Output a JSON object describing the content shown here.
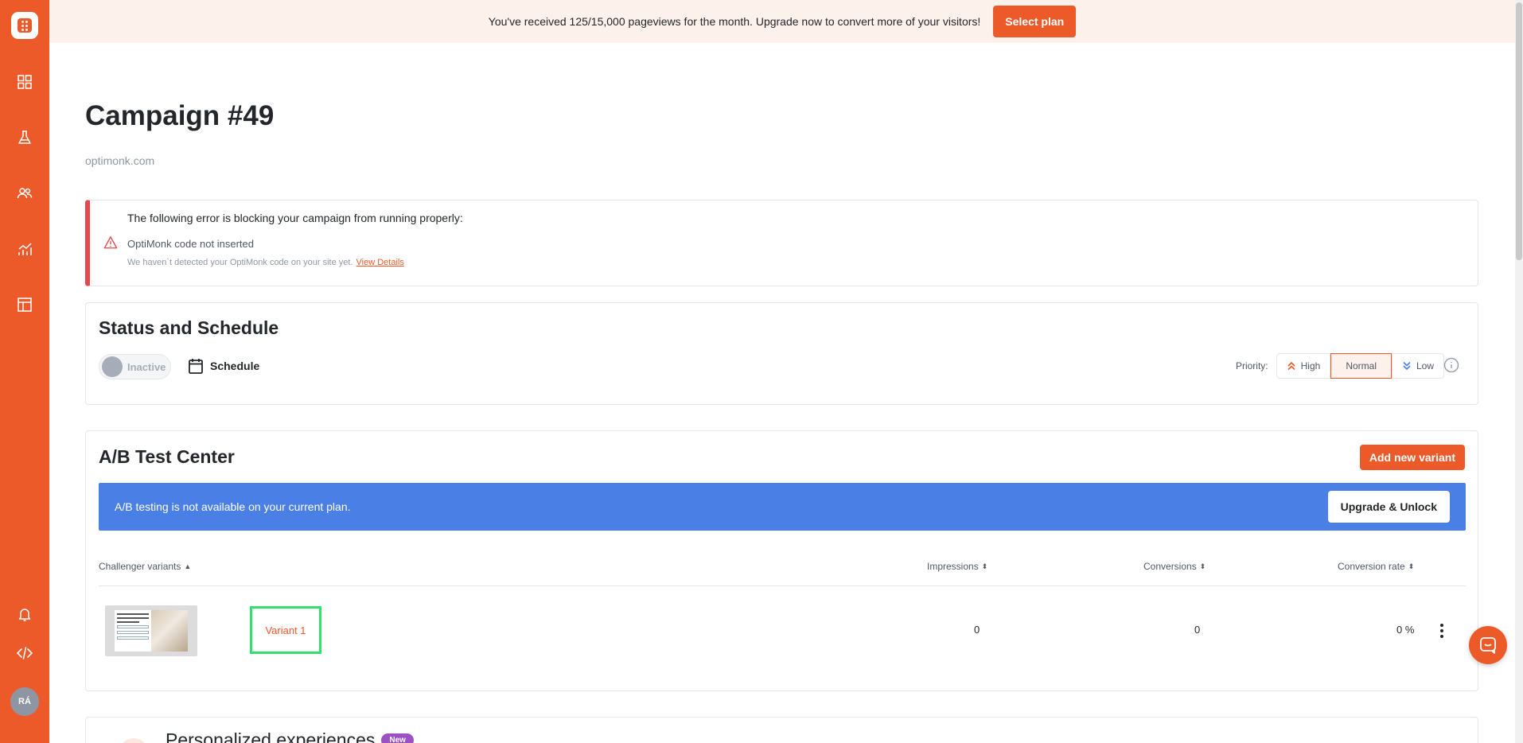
{
  "banner": {
    "text": "You've received 125/15,000 pageviews for the month. Upgrade now to convert more of your visitors!",
    "button": "Select plan"
  },
  "sidebar": {
    "items": [
      {
        "icon": "dashboard-icon"
      },
      {
        "icon": "flask-icon"
      },
      {
        "icon": "users-icon"
      },
      {
        "icon": "analytics-icon"
      },
      {
        "icon": "templates-icon"
      }
    ],
    "bottom": [
      {
        "icon": "bell-icon"
      },
      {
        "icon": "code-icon"
      }
    ],
    "avatar": "RÁ"
  },
  "header": {
    "title": "Campaign #49",
    "domain": "optimonk.com"
  },
  "error": {
    "title": "The following error is blocking your campaign from running properly:",
    "subtitle": "OptiMonk code not inserted",
    "description": "We haven`t detected your OptiMonk code on your site yet.",
    "link": "View Details"
  },
  "status": {
    "title": "Status and Schedule",
    "toggle_label": "Inactive",
    "schedule_label": "Schedule",
    "priority_label": "Priority:",
    "priority_options": [
      "High",
      "Normal",
      "Low"
    ],
    "priority_selected": "Normal"
  },
  "ab": {
    "title": "A/B Test Center",
    "add_button": "Add new variant",
    "notice": "A/B testing is not available on your current plan.",
    "upgrade_button": "Upgrade & Unlock",
    "columns": {
      "variants": "Challenger variants",
      "impressions": "Impressions",
      "conversions": "Conversions",
      "rate": "Conversion rate"
    },
    "rows": [
      {
        "name": "Variant 1",
        "impressions": "0",
        "conversions": "0",
        "rate": "0 %"
      }
    ]
  },
  "personalized": {
    "title": "Personalized experiences",
    "badge": "New"
  },
  "colors": {
    "brand": "#ed5a29",
    "error": "#e5474c",
    "info_banner": "#4a7fe5",
    "badge": "#9b51c3"
  }
}
